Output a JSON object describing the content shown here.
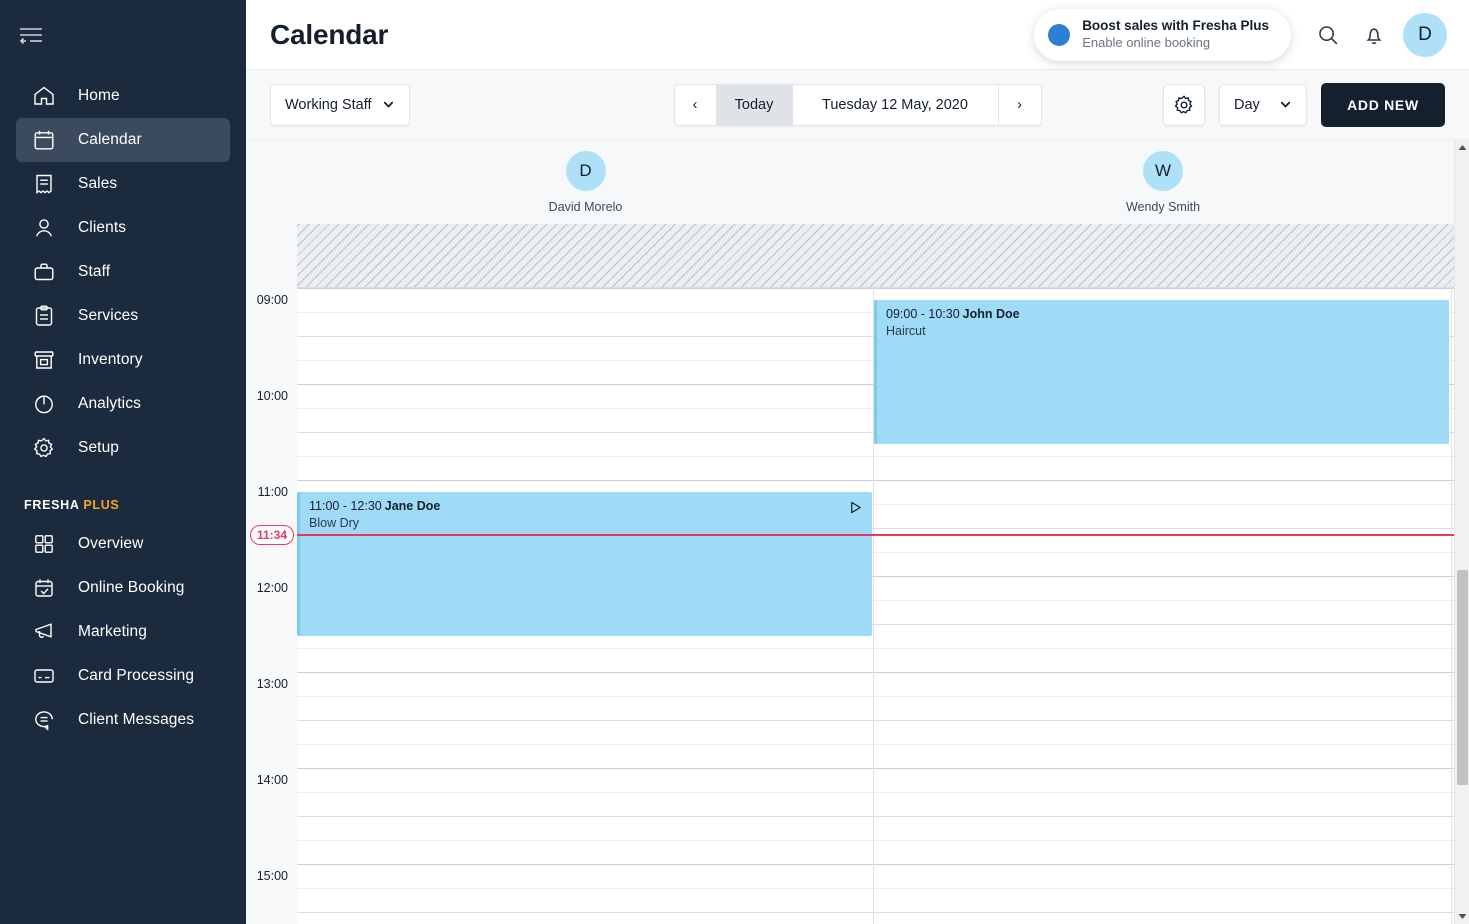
{
  "sidebar": {
    "collapse_icon": "collapse-menu-icon",
    "items": [
      {
        "label": "Home",
        "icon": "home-icon",
        "active": false
      },
      {
        "label": "Calendar",
        "icon": "calendar-icon",
        "active": true
      },
      {
        "label": "Sales",
        "icon": "receipt-icon",
        "active": false
      },
      {
        "label": "Clients",
        "icon": "person-icon",
        "active": false
      },
      {
        "label": "Staff",
        "icon": "briefcase-icon",
        "active": false
      },
      {
        "label": "Services",
        "icon": "clipboard-icon",
        "active": false
      },
      {
        "label": "Inventory",
        "icon": "inventory-box-icon",
        "active": false
      },
      {
        "label": "Analytics",
        "icon": "pie-chart-icon",
        "active": false
      },
      {
        "label": "Setup",
        "icon": "gear-icon",
        "active": false
      }
    ],
    "plus_section": {
      "title_main": "FRESHA",
      "title_accent": "PLUS",
      "accent_color": "#f5a623",
      "items": [
        {
          "label": "Overview",
          "icon": "grid-squares-icon"
        },
        {
          "label": "Online Booking",
          "icon": "calendar-check-icon"
        },
        {
          "label": "Marketing",
          "icon": "megaphone-icon"
        },
        {
          "label": "Card Processing",
          "icon": "credit-card-icon"
        },
        {
          "label": "Client Messages",
          "icon": "chat-bubble-icon"
        }
      ]
    },
    "background_color": "#1c2a3e",
    "active_item_color": "#3c4a5d"
  },
  "header": {
    "title": "Calendar",
    "promo": {
      "title": "Boost sales with Fresha Plus",
      "subtitle": "Enable online booking",
      "dot_color": "#2d7fd3"
    },
    "search_icon": "search-icon",
    "notifications_icon": "bell-icon",
    "avatar_initial": "D",
    "avatar_color": "#aee0f7"
  },
  "toolbar": {
    "staff_filter_label": "Working Staff",
    "prev_label": "‹",
    "today_label": "Today",
    "date_label": "Tuesday 12 May, 2020",
    "next_label": "›",
    "settings_icon": "gear-icon",
    "view_label": "Day",
    "add_new_label": "ADD NEW",
    "add_new_color": "#14202e"
  },
  "calendar": {
    "staff": [
      {
        "initial": "D",
        "name": "David Morelo"
      },
      {
        "initial": "W",
        "name": "Wendy Smith"
      }
    ],
    "time_labels": [
      "09:00",
      "10:00",
      "11:00",
      "12:00",
      "13:00",
      "14:00",
      "15:00"
    ],
    "current_time": "11:34",
    "current_time_color": "#e8395c",
    "appointment_color": "#9fdbf6",
    "appointments": [
      {
        "staff": "David Morelo",
        "time": "11:00 - 12:30",
        "client": "Jane Doe",
        "service": "Blow Dry",
        "has_play_icon": true,
        "play_icon": "play-triangle-icon"
      },
      {
        "staff": "Wendy Smith",
        "time": "09:00 - 10:30",
        "client": "John Doe",
        "service": "Haircut",
        "has_play_icon": false,
        "play_icon": ""
      }
    ]
  }
}
